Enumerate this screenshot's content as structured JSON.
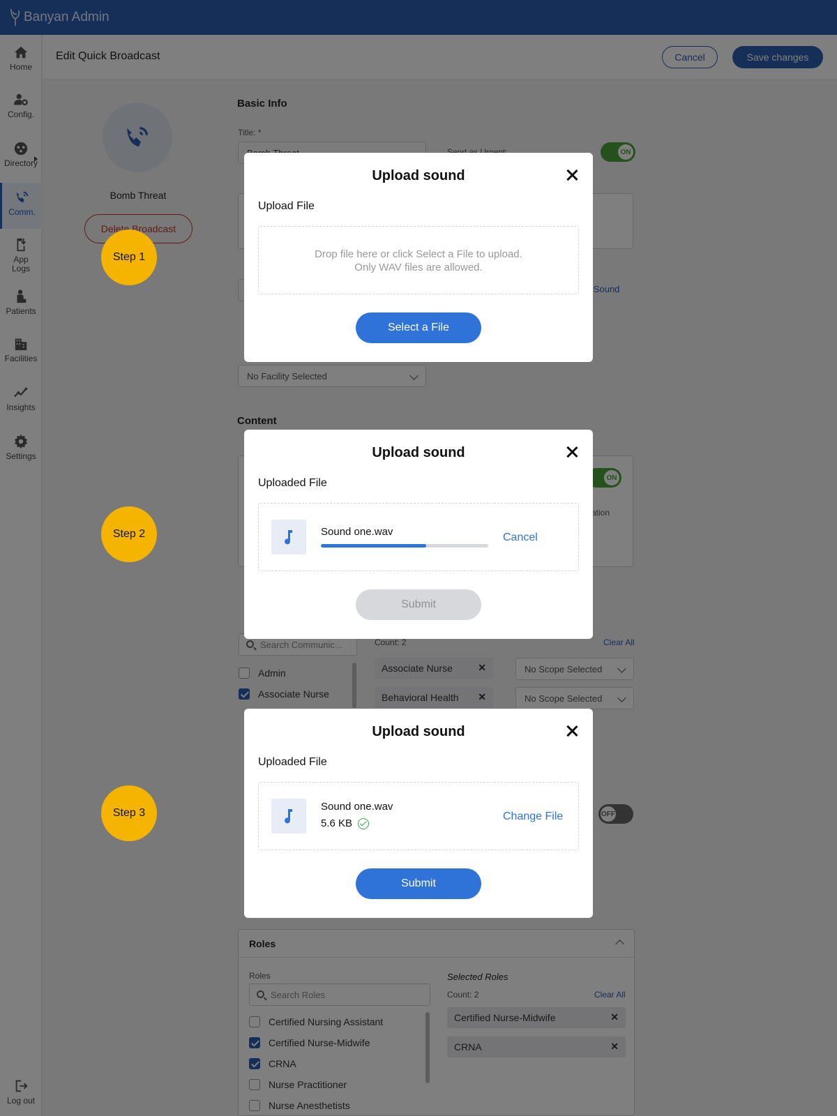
{
  "app": {
    "title": "Banyan Admin"
  },
  "nav": [
    {
      "label": "Home",
      "icon": "home-icon"
    },
    {
      "label": "Config.",
      "icon": "user-gear-icon"
    },
    {
      "label": "Directory",
      "icon": "directory-icon"
    },
    {
      "label": "Comm.",
      "icon": "broadcast-icon",
      "active": true
    },
    {
      "label": "App Logs",
      "icon": "app-logs-icon"
    },
    {
      "label": "Patients",
      "icon": "patient-icon"
    },
    {
      "label": "Facilities",
      "icon": "building-icon"
    },
    {
      "label": "Insights",
      "icon": "insights-icon"
    },
    {
      "label": "Settings",
      "icon": "gear-icon"
    },
    {
      "label": "Log out",
      "icon": "logout-icon"
    }
  ],
  "header": {
    "title": "Edit Quick Broadcast",
    "cancel_label": "Cancel",
    "save_label": "Save changes"
  },
  "profile": {
    "name": "Bomb Threat",
    "delete_label": "Delete Broadcast"
  },
  "form": {
    "basic_info_title": "Basic Info",
    "title_label": "Title: *",
    "title_value": "Bomb Threat",
    "urgent_label": "Send as Urgent:",
    "urgent_state": "ON",
    "upload_sound_link": "Upload Sound",
    "facility_placeholder": "No Facility Selected",
    "content_title": "Content",
    "content_toggle_state": "ON",
    "content_text_fragment_1": "cation",
    "content_text_fragment_2": "t",
    "count_label": "Count: 2",
    "clear_all_label": "Clear All",
    "comm_search_placeholder": "Search Communic...",
    "comm_items": [
      {
        "label": "Admin",
        "checked": false
      },
      {
        "label": "Associate Nurse",
        "checked": true
      }
    ],
    "selected_comm_chips": [
      "Associate Nurse",
      "Behavioral Health"
    ],
    "scope_placeholder": "No Scope Selected",
    "off_toggle_state": "OFF",
    "roles_panel_title": "Roles",
    "roles_label": "Roles",
    "roles_search_placeholder": "Search Roles",
    "roles_items": [
      {
        "label": "Certified Nursing Assistant",
        "checked": false
      },
      {
        "label": "Certified Nurse-Midwife",
        "checked": true
      },
      {
        "label": "CRNA",
        "checked": true
      },
      {
        "label": "Nurse Practitioner",
        "checked": false
      },
      {
        "label": "Nurse Anesthetists",
        "checked": false
      }
    ],
    "selected_roles_title": "Selected Roles",
    "selected_roles_count": "Count: 2",
    "selected_roles_clear": "Clear All",
    "selected_roles_chips": [
      "Certified Nurse-Midwife",
      "CRNA"
    ]
  },
  "steps": [
    "Step 1",
    "Step 2",
    "Step 3"
  ],
  "modal1": {
    "title": "Upload sound",
    "subtitle": "Upload File",
    "drop_line1": "Drop file here or click Select a File to upload.",
    "drop_line2": "Only WAV files are allowed.",
    "button": "Select a File"
  },
  "modal2": {
    "title": "Upload sound",
    "subtitle": "Uploaded File",
    "file_name": "Sound one.wav",
    "progress": 0.63,
    "action": "Cancel",
    "button": "Submit"
  },
  "modal3": {
    "title": "Upload sound",
    "subtitle": "Uploaded File",
    "file_name": "Sound one.wav",
    "file_size": "5.6 KB",
    "action": "Change File",
    "button": "Submit"
  },
  "colors": {
    "brand": "#2c5fb0",
    "accent": "#2f73d9",
    "step": "#f5b400",
    "toggle_on": "#4aa33a"
  }
}
